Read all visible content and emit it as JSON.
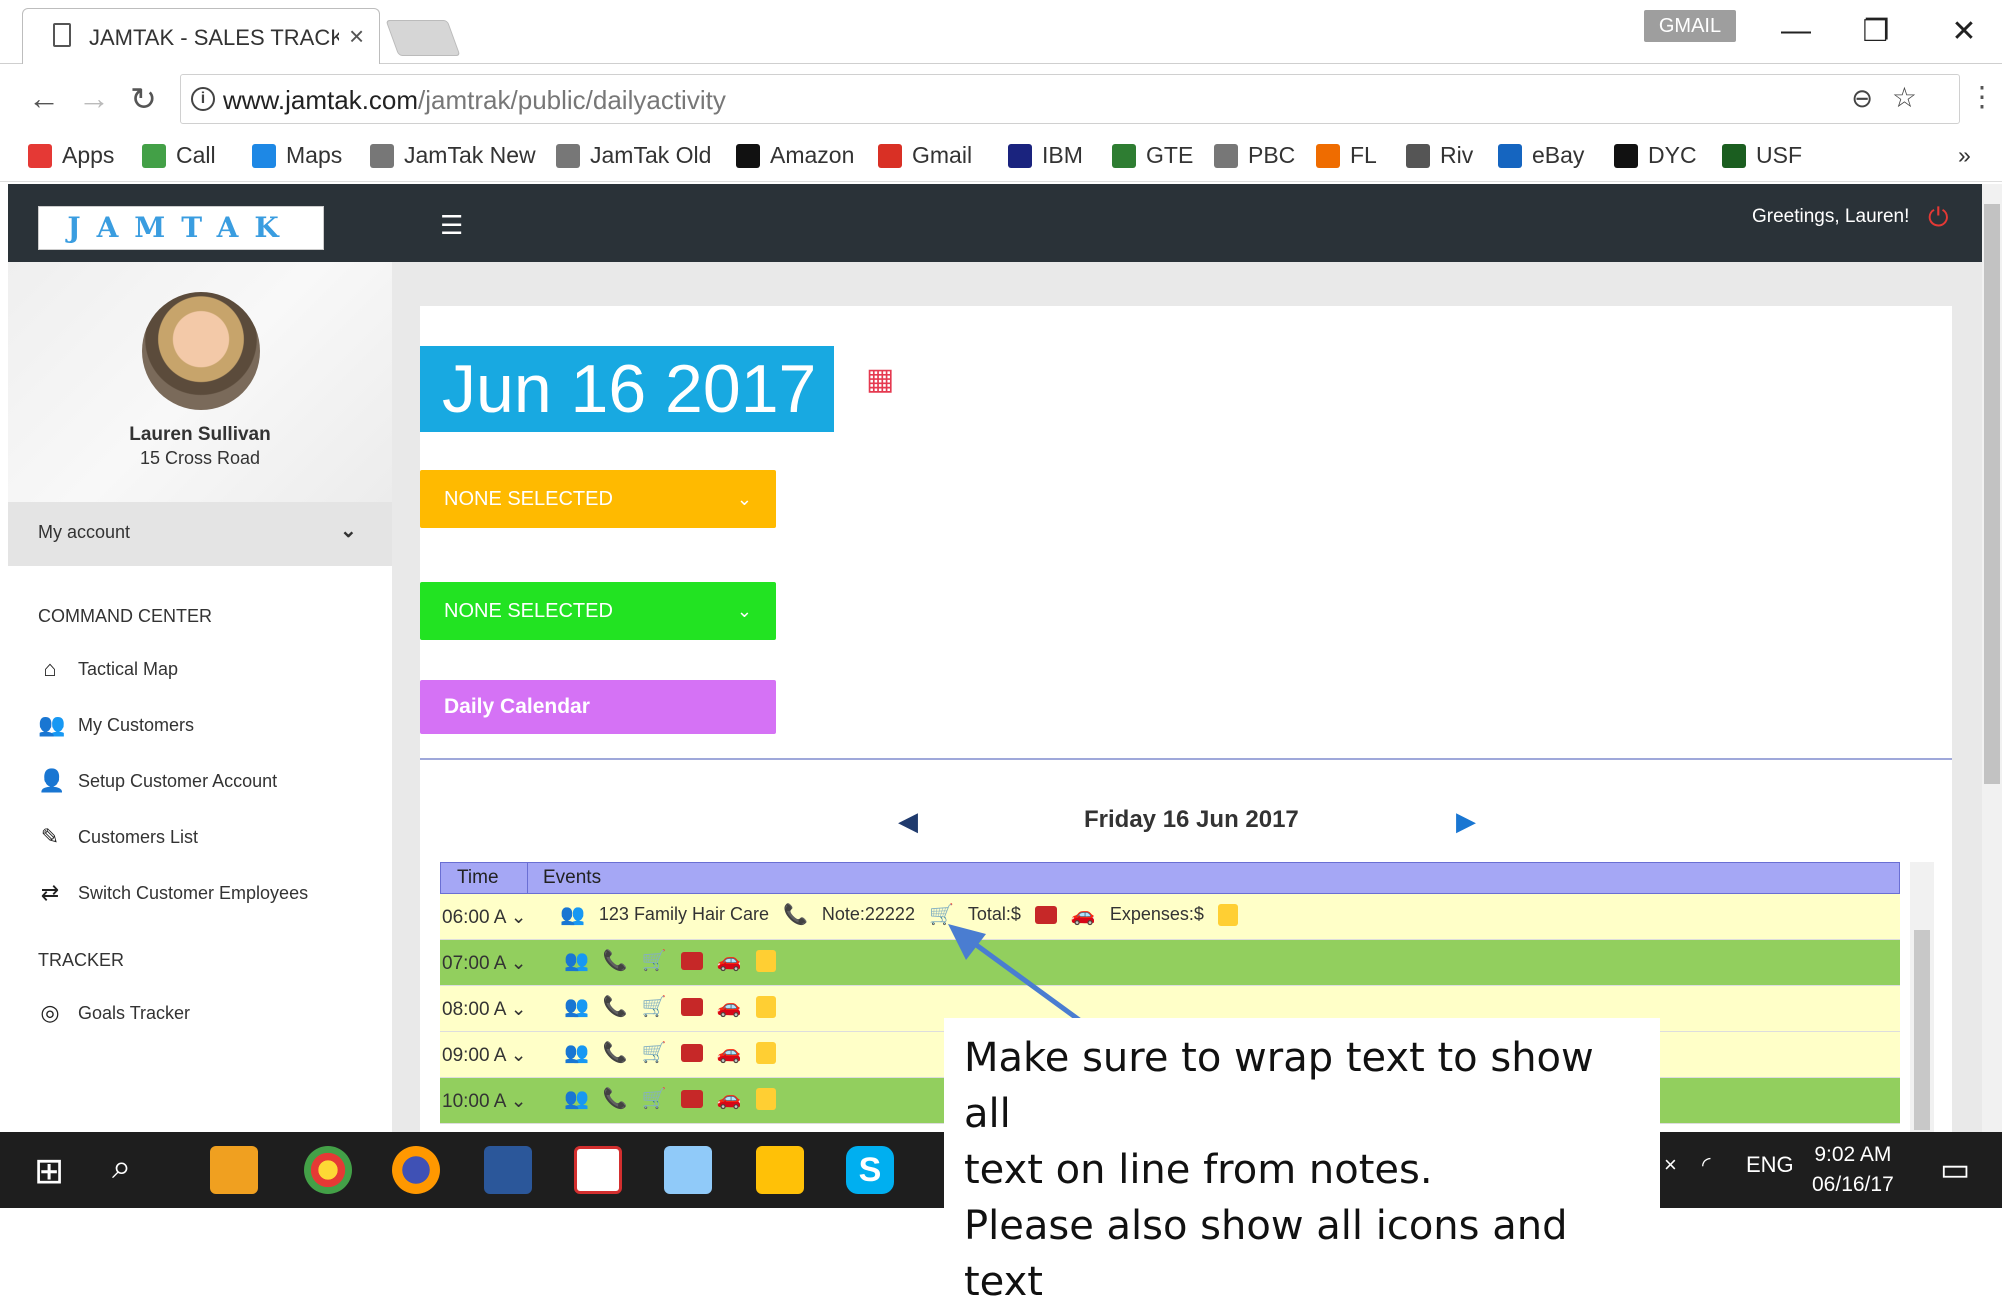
{
  "browser": {
    "tab_title": "JAMTAK - SALES TRACKE",
    "tab_close": "×",
    "gmail_label": "GMAIL",
    "url_host": "www.jamtak.com",
    "url_path": "/jamtrak/public/dailyactivity",
    "bookmarks": [
      "Apps",
      "Call",
      "Maps",
      "JamTak New",
      "JamTak Old",
      "Amazon",
      "Gmail",
      "IBM",
      "GTE",
      "PBC",
      "FL",
      "Riv",
      "eBay",
      "DYC",
      "USF"
    ],
    "bookmarks_more": "»"
  },
  "app": {
    "logo_text": "JAMTAK",
    "greeting": "Greetings, Lauren!",
    "user_name": "Lauren Sullivan",
    "user_address": "15 Cross Road",
    "my_account": "My account",
    "section_command": "COMMAND CENTER",
    "menu_command": [
      "Tactical Map",
      "My Customers",
      "Setup Customer Account",
      "Customers List",
      "Switch Customer Employees"
    ],
    "section_tracker": "TRACKER",
    "menu_tracker": [
      "Goals Tracker"
    ]
  },
  "main": {
    "date_big": "Jun 16 2017",
    "dropdown1": "NONE SELECTED",
    "dropdown2": "NONE SELECTED",
    "daily_calendar": "Daily Calendar",
    "day_title": "Friday 16 Jun 2017",
    "col_time": "Time",
    "col_events": "Events",
    "rows": [
      {
        "time": "06:00 A",
        "customer": "123 Family Hair Care",
        "note": "Note:22222",
        "total": "Total:$",
        "expenses": "Expenses:$"
      },
      {
        "time": "07:00 A"
      },
      {
        "time": "08:00 A"
      },
      {
        "time": "09:00 A"
      },
      {
        "time": "10:00 A"
      }
    ]
  },
  "callout": {
    "line1": "Make sure to wrap text to show all",
    "line2": "text on line from notes.",
    "line3": "Please also show all icons and text"
  },
  "taskbar": {
    "lang": "ENG",
    "time": "9:02 AM",
    "date": "06/16/17"
  },
  "colors": {
    "date_blue": "#18a9e1",
    "dropdown_orange": "#ffba00",
    "dropdown_green": "#22e322",
    "calendar_purple": "#d572f5",
    "row_yellow": "#ffffc8",
    "row_green": "#92cf5e",
    "header_dark": "#2a3238"
  }
}
